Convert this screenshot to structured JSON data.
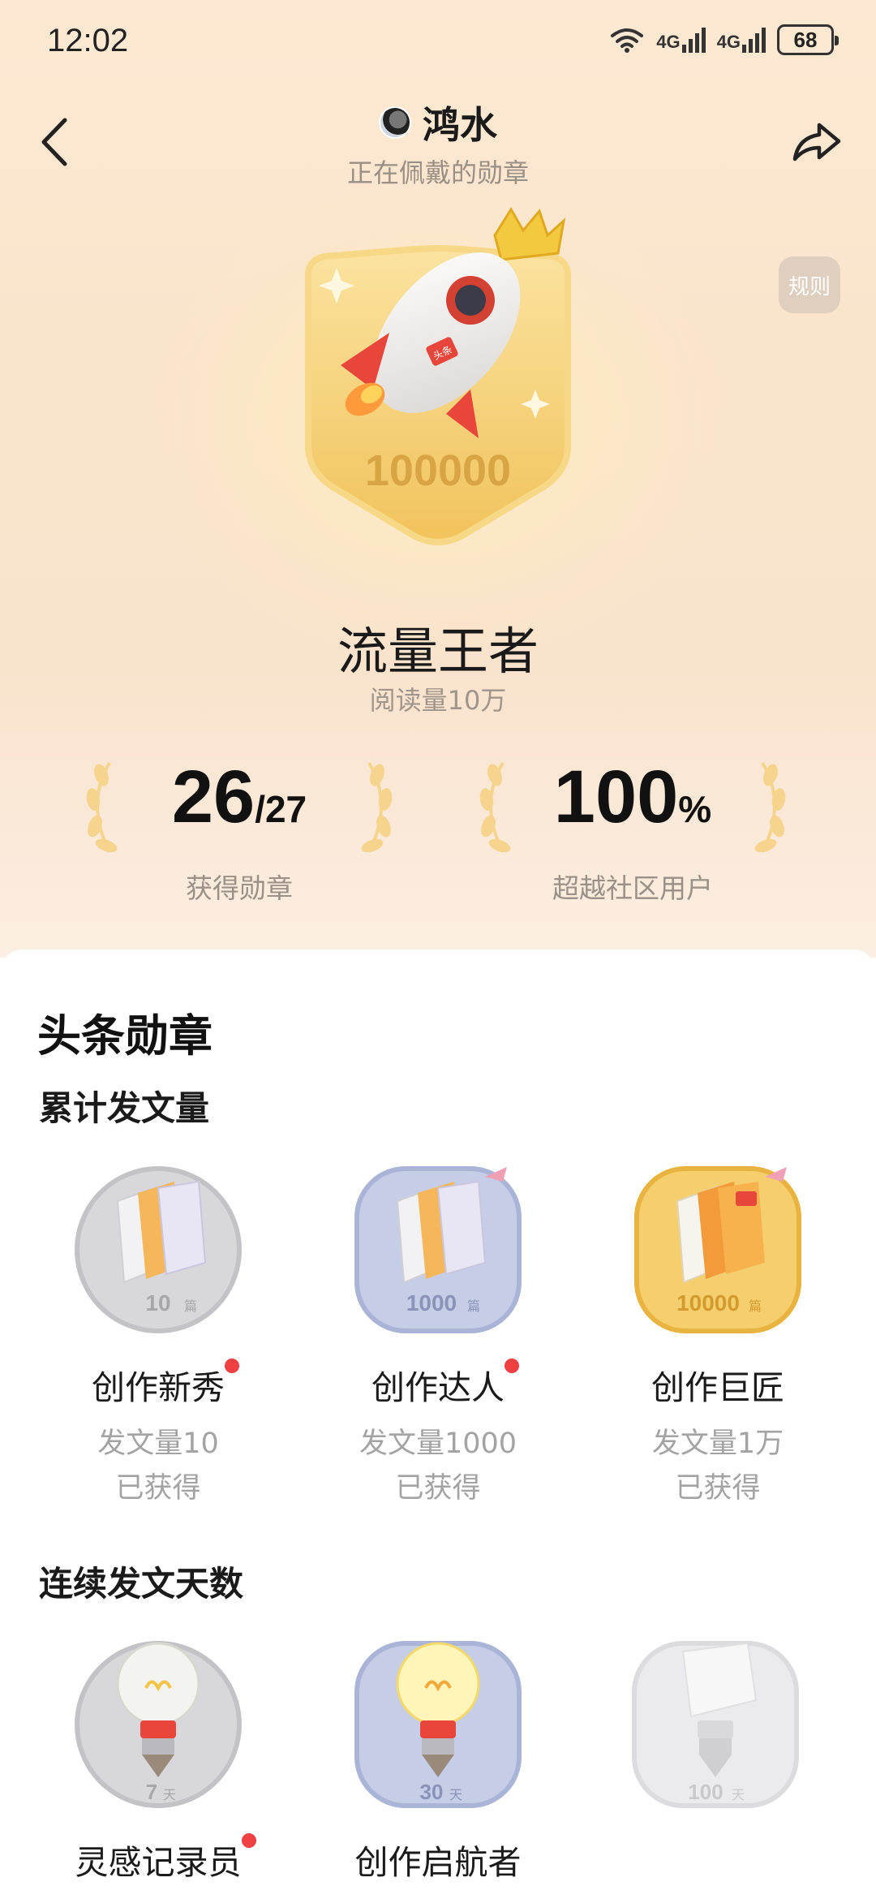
{
  "status": {
    "time": "12:02",
    "battery": "68",
    "net1": "4G",
    "net2": "4G"
  },
  "header": {
    "username": "鸿水",
    "subtitle": "正在佩戴的勋章",
    "rule": "规则"
  },
  "featured": {
    "number": "100000",
    "brand": "头条",
    "title": "流量王者",
    "desc": "阅读量10万"
  },
  "stats": [
    {
      "value": "26",
      "total": "/27",
      "label": "获得勋章"
    },
    {
      "value": "100",
      "unit": "%",
      "label": "超越社区用户"
    }
  ],
  "section": {
    "title": "头条勋章"
  },
  "groups": [
    {
      "title": "累计发文量",
      "medals": [
        {
          "name": "创作新秀",
          "req": "发文量10",
          "status": "已获得",
          "count": "10",
          "unit": "篇",
          "dot": true,
          "tier": "silver"
        },
        {
          "name": "创作达人",
          "req": "发文量1000",
          "status": "已获得",
          "count": "1000",
          "unit": "篇",
          "dot": true,
          "tier": "blue"
        },
        {
          "name": "创作巨匠",
          "req": "发文量1万",
          "status": "已获得",
          "count": "10000",
          "unit": "篇",
          "dot": false,
          "tier": "gold"
        }
      ]
    },
    {
      "title": "连续发文天数",
      "medals": [
        {
          "name": "灵感记录员",
          "count": "7",
          "unit": "天",
          "dot": true,
          "tier": "silver"
        },
        {
          "name": "创作启航者",
          "count": "30",
          "unit": "天",
          "dot": false,
          "tier": "blue"
        },
        {
          "name": "",
          "count": "100",
          "unit": "天",
          "dot": false,
          "tier": "locked"
        }
      ]
    }
  ],
  "colors": {
    "dot": "#f04142",
    "gold": "#e9b340",
    "silver": "#c9c9cc",
    "blue": "#aab4d6"
  }
}
